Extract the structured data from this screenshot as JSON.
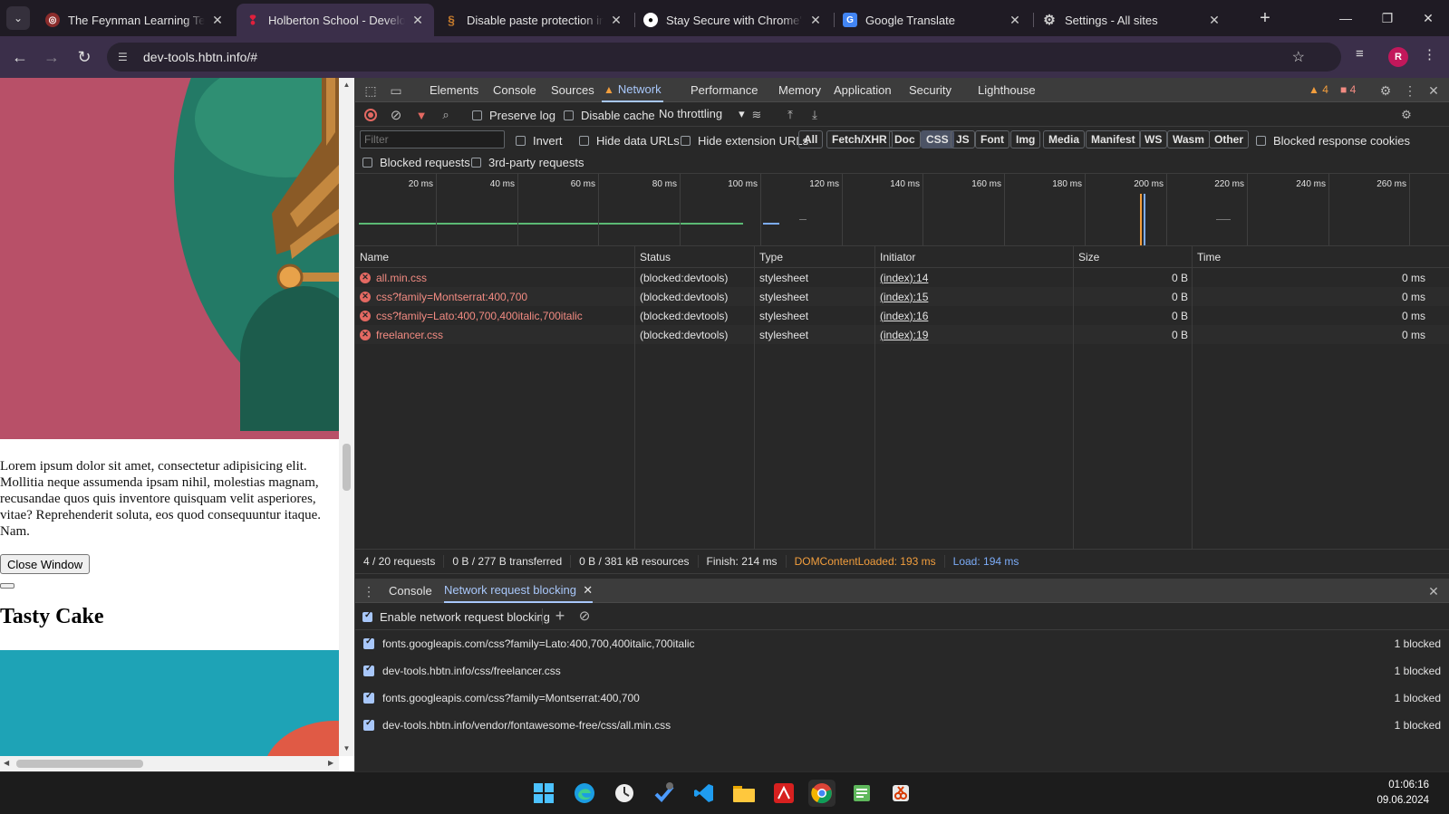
{
  "browser": {
    "tabs": [
      {
        "title": "The Feynman Learning Techni",
        "favicon": "feynman-icon",
        "favicon_color": "#8b2c2c"
      },
      {
        "title": "Holberton School - Develope",
        "favicon": "holberton-icon",
        "favicon_color": "#e0203c",
        "active": true
      },
      {
        "title": "Disable paste protection in C",
        "favicon": "article-icon",
        "favicon_color": "#c47a2c"
      },
      {
        "title": "Stay Secure with Chrome's N",
        "favicon": "medium-icon",
        "favicon_color": "#000000"
      },
      {
        "title": "Google Translate",
        "favicon": "translate-icon",
        "favicon_color": "#4285f4"
      },
      {
        "title": "Settings - All sites",
        "favicon": "gear-icon",
        "favicon_color": "#9aa0a6"
      }
    ],
    "url": "dev-tools.hbtn.info/#",
    "profile_initial": "R"
  },
  "page": {
    "lorem": "Lorem ipsum dolor sit amet, consectetur adipisicing elit. Mollitia neque assumenda ipsam nihil, molestias magnam, recusandae quos quis inventore quisquam velit asperiores, vitae? Reprehenderit soluta, eos quod consequuntur itaque. Nam.",
    "close_button": "Close Window",
    "heading": "Tasty Cake"
  },
  "devtools": {
    "tabs": [
      "Elements",
      "Console",
      "Sources",
      "Network",
      "Performance",
      "Memory",
      "Application",
      "Security",
      "Lighthouse"
    ],
    "active_tab": "Network",
    "warnings_count": "4",
    "errors_count": "4",
    "toolbar": {
      "preserve_log": "Preserve log",
      "disable_cache": "Disable cache",
      "throttling": "No throttling"
    },
    "filter": {
      "placeholder": "Filter",
      "invert": "Invert",
      "hide_data_urls": "Hide data URLs",
      "hide_extension_urls": "Hide extension URLs",
      "types": [
        "All",
        "Fetch/XHR",
        "Doc",
        "CSS",
        "JS",
        "Font",
        "Img",
        "Media",
        "Manifest",
        "WS",
        "Wasm",
        "Other"
      ],
      "active_type": "CSS",
      "blocked_response_cookies": "Blocked response cookies",
      "blocked_requests": "Blocked requests",
      "third_party": "3rd-party requests"
    },
    "overview_ticks": [
      "20 ms",
      "40 ms",
      "60 ms",
      "80 ms",
      "100 ms",
      "120 ms",
      "140 ms",
      "160 ms",
      "180 ms",
      "200 ms",
      "220 ms",
      "240 ms",
      "260 ms"
    ],
    "columns": [
      "Name",
      "Status",
      "Type",
      "Initiator",
      "Size",
      "Time"
    ],
    "requests": [
      {
        "name": "all.min.css",
        "status": "(blocked:devtools)",
        "type": "stylesheet",
        "initiator": "(index):14",
        "size": "0 B",
        "time": "0 ms"
      },
      {
        "name": "css?family=Montserrat:400,700",
        "status": "(blocked:devtools)",
        "type": "stylesheet",
        "initiator": "(index):15",
        "size": "0 B",
        "time": "0 ms"
      },
      {
        "name": "css?family=Lato:400,700,400italic,700italic",
        "status": "(blocked:devtools)",
        "type": "stylesheet",
        "initiator": "(index):16",
        "size": "0 B",
        "time": "0 ms"
      },
      {
        "name": "freelancer.css",
        "status": "(blocked:devtools)",
        "type": "stylesheet",
        "initiator": "(index):19",
        "size": "0 B",
        "time": "0 ms"
      }
    ],
    "summary": {
      "requests": "4 / 20 requests",
      "transferred": "0 B / 277 B transferred",
      "resources": "0 B / 381 kB resources",
      "finish": "Finish: 214 ms",
      "dom_content_loaded": "DOMContentLoaded: 193 ms",
      "load": "Load: 194 ms"
    },
    "drawer": {
      "tabs": [
        "Console",
        "Network request blocking"
      ],
      "active_tab": "Network request blocking",
      "enable_label": "Enable network request blocking",
      "patterns": [
        {
          "url": "fonts.googleapis.com/css?family=Lato:400,700,400italic,700italic",
          "count": "1 blocked"
        },
        {
          "url": "dev-tools.hbtn.info/css/freelancer.css",
          "count": "1 blocked"
        },
        {
          "url": "fonts.googleapis.com/css?family=Montserrat:400,700",
          "count": "1 blocked"
        },
        {
          "url": "dev-tools.hbtn.info/vendor/fontawesome-free/css/all.min.css",
          "count": "1 blocked"
        }
      ]
    }
  },
  "taskbar": {
    "apps": [
      "windows-start-icon",
      "edge-icon",
      "clock-app-icon",
      "vpn-icon",
      "vscode-icon",
      "file-explorer-icon",
      "acrobat-icon",
      "chrome-icon",
      "notepad-icon",
      "snipping-tool-icon"
    ],
    "time": "01:06:16",
    "date": "09.06.2024"
  },
  "colors": {
    "accent": "#a8c7fa",
    "error": "#f28b82",
    "warning": "#f29e3d",
    "tab_active": "#3b2f4a"
  }
}
